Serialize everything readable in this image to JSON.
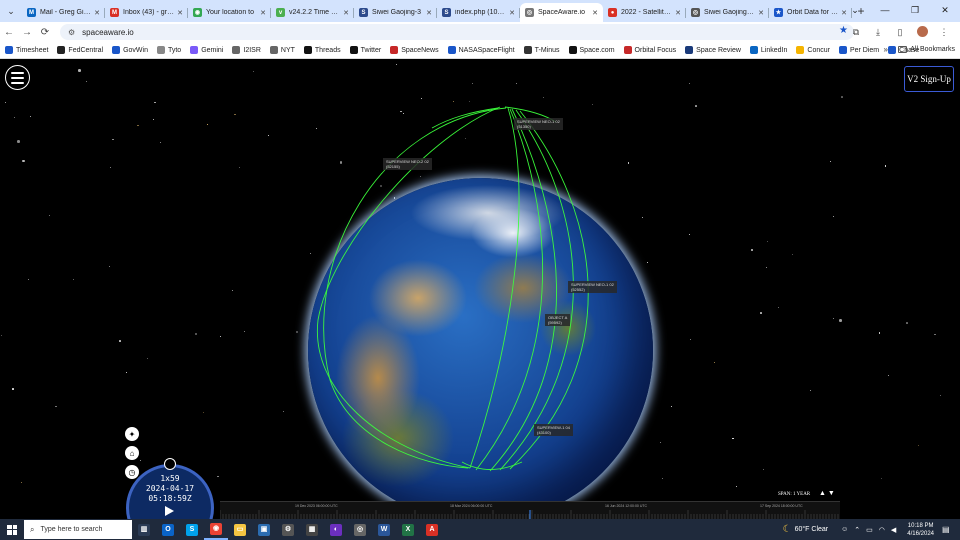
{
  "browser": {
    "tabs": [
      {
        "title": "Mail - Greg Gilling",
        "color": "#0a66c2",
        "glyph": "M"
      },
      {
        "title": "Inbox (43) - greg",
        "color": "#d93025",
        "glyph": "M"
      },
      {
        "title": "Your location to",
        "color": "#34a853",
        "glyph": "◉"
      },
      {
        "title": "v24.2.2 Time — T",
        "color": "#4caf50",
        "glyph": "v"
      },
      {
        "title": "Siwei Gaojing-3",
        "color": "#2c4a8c",
        "glyph": "S"
      },
      {
        "title": "index.php (1080-",
        "color": "#2c4a8c",
        "glyph": "S"
      },
      {
        "title": "SpaceAware.io",
        "color": "#777",
        "glyph": "◎",
        "active": true
      },
      {
        "title": "2022 - Satellite &",
        "color": "#d93025",
        "glyph": "●"
      },
      {
        "title": "Siwei Gaojing 3-0",
        "color": "#555",
        "glyph": "◎"
      },
      {
        "title": "Orbit Data for 41",
        "color": "#1a56c9",
        "glyph": "★"
      }
    ],
    "new_tab": "+",
    "window_controls": [
      "⌄",
      "—",
      "❐",
      "✕"
    ],
    "url": "spaceaware.io",
    "bookmarks": [
      {
        "label": "Timesheet",
        "color": "#1a56c9"
      },
      {
        "label": "FedCentral",
        "color": "#222"
      },
      {
        "label": "GovWin",
        "color": "#1a56c9"
      },
      {
        "label": "Tyto",
        "color": "#888"
      },
      {
        "label": "Gemini",
        "color": "#7a5af8"
      },
      {
        "label": "I2ISR",
        "color": "#666"
      },
      {
        "label": "NYT",
        "color": "#666"
      },
      {
        "label": "Threads",
        "color": "#111"
      },
      {
        "label": "Twitter",
        "color": "#111"
      },
      {
        "label": "SpaceNews",
        "color": "#c62828"
      },
      {
        "label": "NASASpaceFlight",
        "color": "#1a56c9"
      },
      {
        "label": "T-Minus",
        "color": "#333"
      },
      {
        "label": "Space.com",
        "color": "#111"
      },
      {
        "label": "Orbital Focus",
        "color": "#c62828"
      },
      {
        "label": "Space Review",
        "color": "#1a3a7a"
      },
      {
        "label": "LinkedIn",
        "color": "#0a66c2"
      },
      {
        "label": "Concur",
        "color": "#f5b400"
      },
      {
        "label": "Per Diem",
        "color": "#1a56c9"
      },
      {
        "label": "Chase",
        "color": "#1a56c9"
      }
    ],
    "bookmarks_more": "»",
    "all_bookmarks": "All Bookmarks"
  },
  "app": {
    "signup_label": "V2 Sign-Up",
    "satellite_labels": [
      {
        "name": "SUPERVIEW NEO-1 02",
        "id": "(51350)"
      },
      {
        "name": "SUPERVIEW NEO-2 02",
        "id": "(52155)"
      },
      {
        "name": "SUPERVIEW NEO-1 02",
        "id": "(52552)"
      },
      {
        "name": "OBJECT A",
        "id": "(59592)"
      },
      {
        "name": "SUPERVIEW-1 04",
        "id": "(43100)"
      }
    ],
    "clock": {
      "speed": "1x59",
      "date": "2024-04-17",
      "time": "05:18:59Z"
    },
    "timeline": {
      "labels": [
        "19 Dec 2023 06:00:00 UTC",
        "18 Mar 2024 06:00:00 UTC",
        "16 Jun 2024 12:00:00 UTC",
        "17 Sep 2024 18:00:00 UTC"
      ],
      "span_label": "SPAN:",
      "span_value": "1 YEAR"
    }
  },
  "taskbar": {
    "search_placeholder": "Type here to search",
    "apps": [
      {
        "name": "task-view",
        "color": "#2b3b55",
        "glyph": "▥"
      },
      {
        "name": "outlook",
        "color": "#0a64c8",
        "glyph": "O"
      },
      {
        "name": "skype",
        "color": "#00a2ed",
        "glyph": "S"
      },
      {
        "name": "chrome",
        "color": "#ea4335",
        "glyph": "◉",
        "active": true
      },
      {
        "name": "file-explorer",
        "color": "#f5c542",
        "glyph": "▭"
      },
      {
        "name": "photos",
        "color": "#2b6cb0",
        "glyph": "▣"
      },
      {
        "name": "settings",
        "color": "#555",
        "glyph": "⚙"
      },
      {
        "name": "calculator",
        "color": "#444",
        "glyph": "▦"
      },
      {
        "name": "edge",
        "color": "#6b2fbf",
        "glyph": "◐"
      },
      {
        "name": "browser",
        "color": "#666",
        "glyph": "◎"
      },
      {
        "name": "word",
        "color": "#2b579a",
        "glyph": "W"
      },
      {
        "name": "excel",
        "color": "#217346",
        "glyph": "X"
      },
      {
        "name": "acrobat",
        "color": "#d93025",
        "glyph": "A"
      }
    ],
    "weather": "60°F  Clear",
    "time": "10:18 PM",
    "date": "4/16/2024"
  }
}
